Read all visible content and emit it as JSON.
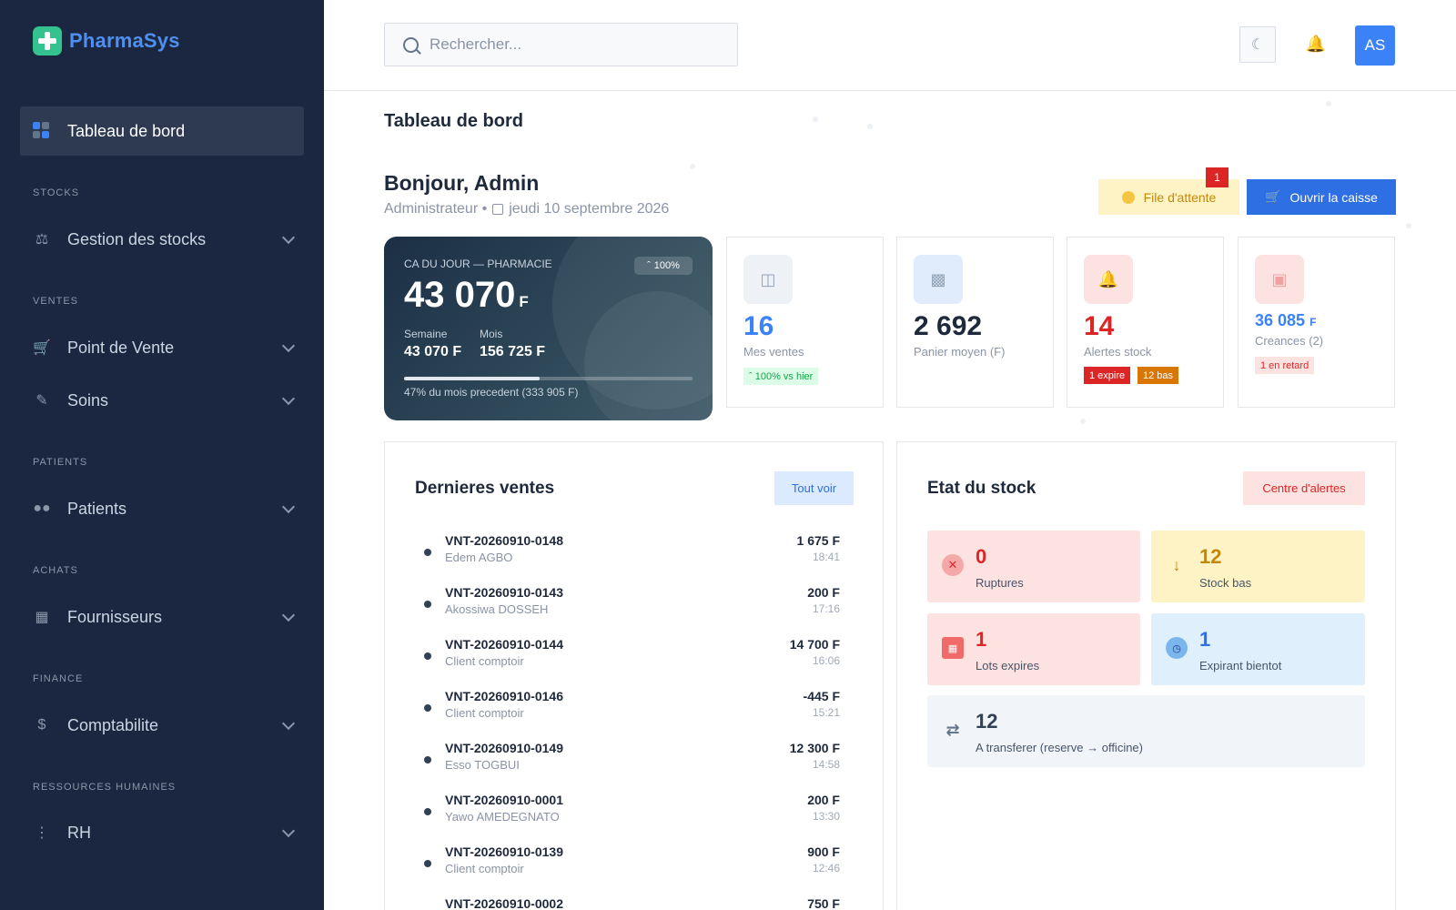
{
  "app": {
    "brand": "PharmaSys"
  },
  "sidebar": {
    "active": {
      "label": "Tableau de bord"
    },
    "sections": [
      {
        "title": "STOCKS",
        "item": "Gestion des stocks"
      },
      {
        "title": "VENTES",
        "item": "Point de Vente"
      },
      {
        "title": "",
        "item": "Soins"
      },
      {
        "title": "PATIENTS",
        "item": "Patients"
      },
      {
        "title": "ACHATS",
        "item": "Fournisseurs"
      },
      {
        "title": "FINANCE",
        "item": "Comptabilite"
      },
      {
        "title": "RESSOURCES HUMAINES",
        "item": "RH"
      }
    ]
  },
  "header": {
    "search_placeholder": "Rechercher...",
    "avatar_initials": "AS"
  },
  "page": {
    "title": "Tableau de bord",
    "greeting": "Bonjour, Admin",
    "role": "Administrateur •",
    "date": "jeudi 10 septembre 2026",
    "queue_label": "File d'attente",
    "queue_count": "1",
    "open_register_label": "Ouvrir la caisse"
  },
  "revenue": {
    "label": "CA DU JOUR — PHARMACIE",
    "badge": "100%",
    "value": "43 070",
    "currency": "F",
    "week_label": "Semaine",
    "week_value": "43 070 F",
    "month_label": "Mois",
    "month_value": "156 725 F",
    "progress_fraction": 0.47,
    "note": "47% du mois precedent (333 905 F)"
  },
  "kpis": {
    "sales": {
      "value": "16",
      "label": "Mes ventes",
      "chip": "100% vs hier"
    },
    "basket": {
      "value": "2 692",
      "label": "Panier moyen (F)"
    },
    "alerts": {
      "value": "14",
      "label": "Alertes stock",
      "chip_expired": "1 expire",
      "chip_low": "12 bas"
    },
    "credits": {
      "value": "36 085",
      "currency": "F",
      "label": "Creances (2)",
      "chip": "1 en retard"
    }
  },
  "recent_sales": {
    "title": "Dernieres ventes",
    "see_all": "Tout voir",
    "rows": [
      {
        "ref": "VNT-20260910-0148",
        "client": "Edem AGBO",
        "amount": "1 675 F",
        "time": "18:41"
      },
      {
        "ref": "VNT-20260910-0143",
        "client": "Akossiwa DOSSEH",
        "amount": "200 F",
        "time": "17:16"
      },
      {
        "ref": "VNT-20260910-0144",
        "client": "Client comptoir",
        "amount": "14 700 F",
        "time": "16:06"
      },
      {
        "ref": "VNT-20260910-0146",
        "client": "Client comptoir",
        "amount": "-445 F",
        "time": "15:21"
      },
      {
        "ref": "VNT-20260910-0149",
        "client": "Esso TOGBUI",
        "amount": "12 300 F",
        "time": "14:58"
      },
      {
        "ref": "VNT-20260910-0001",
        "client": "Yawo AMEDEGNATO",
        "amount": "200 F",
        "time": "13:30"
      },
      {
        "ref": "VNT-20260910-0139",
        "client": "Client comptoir",
        "amount": "900 F",
        "time": "12:46"
      },
      {
        "ref": "VNT-20260910-0002",
        "client": "",
        "amount": "750 F",
        "time": ""
      }
    ]
  },
  "stock_state": {
    "title": "Etat du stock",
    "alerts_center": "Centre d'alertes",
    "tiles": {
      "ruptures": {
        "value": "0",
        "label": "Ruptures"
      },
      "stock_bas": {
        "value": "12",
        "label": "Stock bas"
      },
      "lots_expires": {
        "value": "1",
        "label": "Lots expires"
      },
      "expirant": {
        "value": "1",
        "label": "Expirant bientot"
      },
      "transfer": {
        "value": "12",
        "label": "A transferer (reserve → officine)"
      }
    }
  },
  "colors": {
    "sidebar": "#1b2740",
    "accent": "#2f6fe4",
    "danger": "#dc2626",
    "warning": "#d97706",
    "success": "#16a34a"
  }
}
